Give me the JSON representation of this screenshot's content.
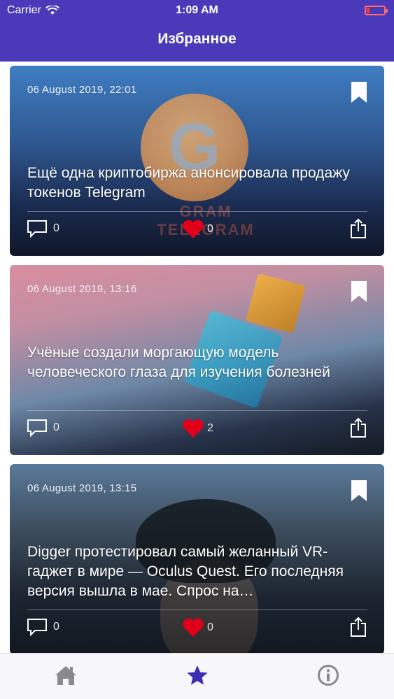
{
  "status_bar": {
    "carrier": "Carrier",
    "time": "1:09 AM"
  },
  "nav": {
    "title": "Избранное"
  },
  "colors": {
    "header": "#4a3aba",
    "like": "#e0001a",
    "active_tab": "#3a2fb0",
    "inactive_tab": "#8a8a8e"
  },
  "articles": [
    {
      "date": "06 August 2019, 22:01",
      "title": "Ещё одна криптобиржа анонсировала продажу токенов Telegram",
      "comments": "0",
      "likes": "0",
      "bookmarked": true,
      "image_caption": "GRAM TELEGRAM"
    },
    {
      "date": "06 August 2019, 13:16",
      "title": "Учёные создали моргающую модель человеческого глаза для изучения болезней",
      "comments": "0",
      "likes": "2",
      "bookmarked": true
    },
    {
      "date": "06 August 2019, 13:15",
      "title": "Digger протестировал самый желанный VR-гаджет в мире — Oculus Quest. Его последняя версия вышла в мае. Спрос на…",
      "comments": "0",
      "likes": "0",
      "bookmarked": true
    }
  ],
  "tabs": [
    {
      "name": "home",
      "icon": "home-icon",
      "active": false
    },
    {
      "name": "favorites",
      "icon": "star-icon",
      "active": true
    },
    {
      "name": "info",
      "icon": "info-icon",
      "active": false
    }
  ]
}
